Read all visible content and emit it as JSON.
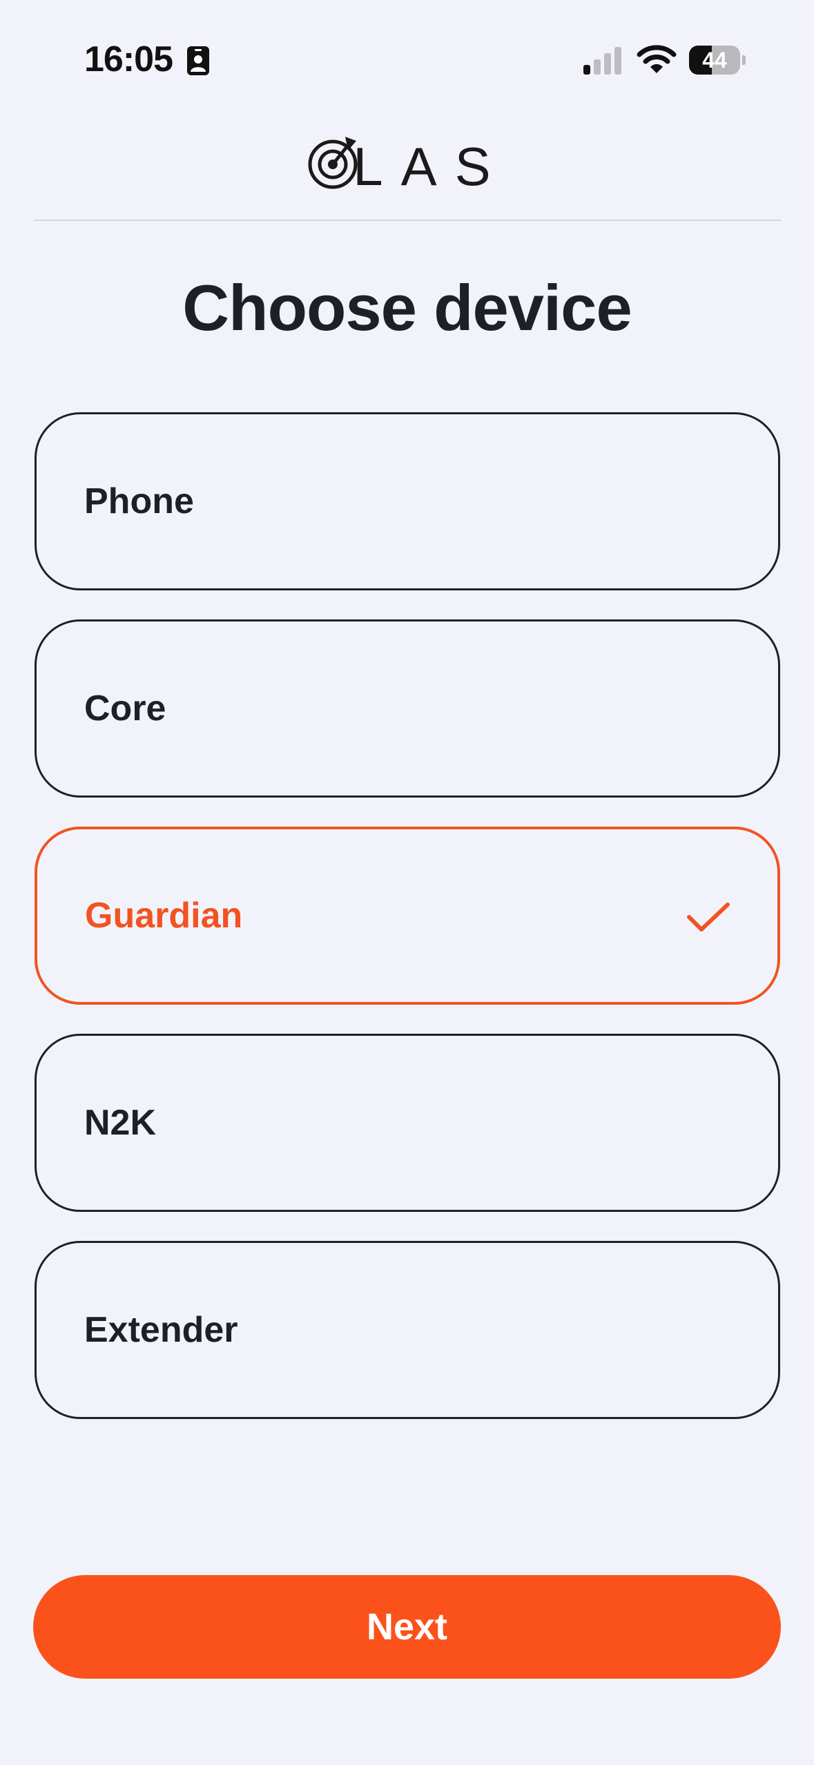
{
  "status_bar": {
    "time": "16:05",
    "battery_level": "44",
    "battery_fraction": 0.44
  },
  "header": {
    "logo_text": "LAS"
  },
  "page": {
    "title": "Choose device"
  },
  "devices": [
    {
      "label": "Phone",
      "selected": false
    },
    {
      "label": "Core",
      "selected": false
    },
    {
      "label": "Guardian",
      "selected": true
    },
    {
      "label": "N2K",
      "selected": false
    },
    {
      "label": "Extender",
      "selected": false
    }
  ],
  "actions": {
    "next_label": "Next"
  },
  "colors": {
    "accent": "#fb511b",
    "selected_border": "#f25322",
    "background": "#f2f3fa",
    "text": "#1f2026"
  }
}
